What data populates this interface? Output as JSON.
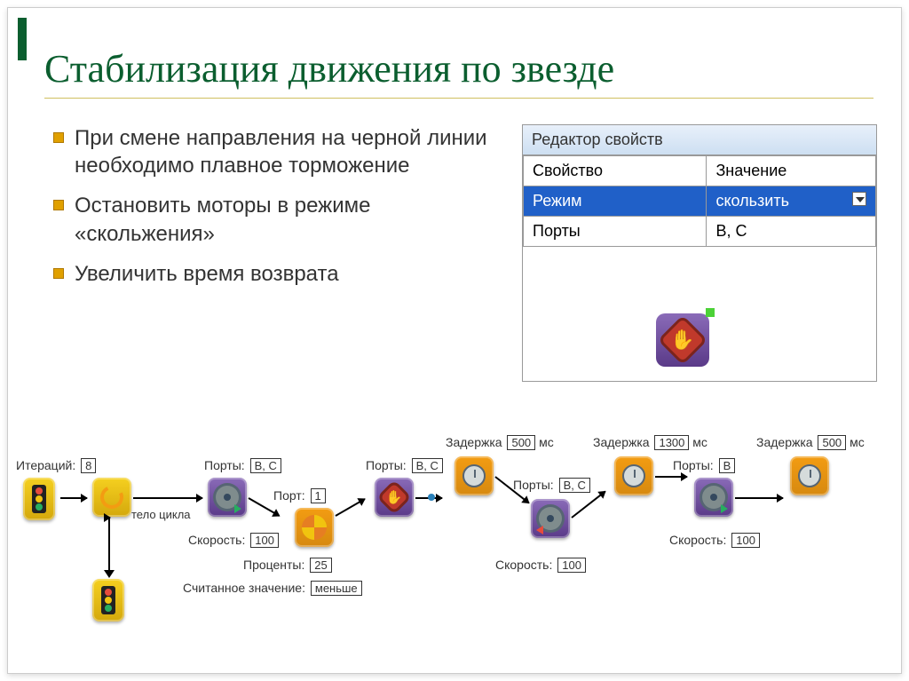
{
  "title": "Стабилизация движения по звезде",
  "bullets": {
    "b1": "При смене направления на черной линии необходимо плавное торможение",
    "b2": "Остановить моторы в режиме «скольжения»",
    "b3": "Увеличить время возврата"
  },
  "panel": {
    "heading": "Редактор свойств",
    "col1": "Свойство",
    "col2": "Значение",
    "row1_prop": "Режим",
    "row1_val": "скользить",
    "row2_prop": "Порты",
    "row2_val": "B, C"
  },
  "flow": {
    "iterations_lbl": "Итераций:",
    "iterations_val": "8",
    "loop_body": "тело цикла",
    "ports_lbl": "Порты:",
    "port_lbl": "Порт:",
    "ports_bc": "B, C",
    "port_1": "1",
    "port_b": "B",
    "speed_lbl": "Скорость:",
    "speed_100": "100",
    "percent_lbl": "Проценты:",
    "percent_val": "25",
    "read_lbl": "Считанное значение:",
    "read_val": "меньше",
    "delay_lbl": "Задержка",
    "delay_500": "500",
    "delay_1300": "1300",
    "delay_ms": "мс"
  }
}
